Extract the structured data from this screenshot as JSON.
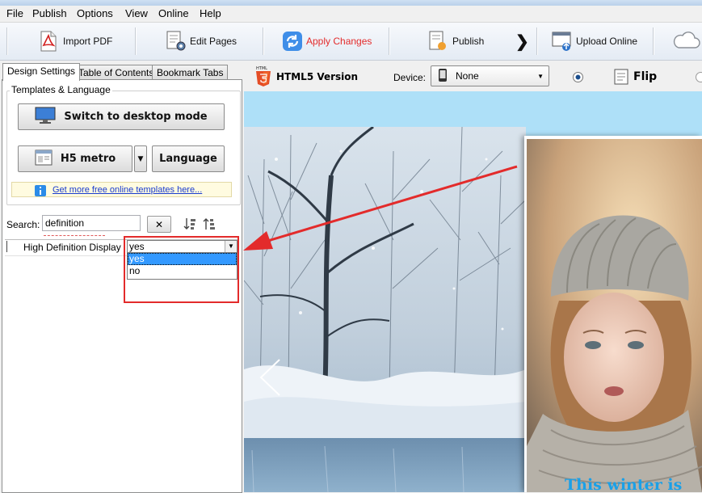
{
  "menu": [
    "File",
    "Publish",
    "Options",
    "View",
    "Online",
    "Help"
  ],
  "toolbar": {
    "import_pdf": "Import PDF",
    "edit_pages": "Edit Pages",
    "apply_changes": "Apply Changes",
    "publish": "Publish",
    "upload_online": "Upload Online"
  },
  "tabs": [
    "Design Settings",
    "Table of Contents",
    "Bookmark Tabs"
  ],
  "templates": {
    "group_label": "Templates & Language",
    "switch_button": "Switch to desktop mode",
    "template_button": "H5 metro",
    "language_button": "Language",
    "more_templates_link": "Get more free online templates here..."
  },
  "search": {
    "label": "Search:",
    "value": "definition"
  },
  "property": {
    "name": "High Definition Display",
    "value": "yes",
    "options": [
      "yes",
      "no"
    ],
    "selected_option": "yes"
  },
  "preview_header": {
    "html5_badge": "HTML",
    "version_label": "HTML5 Version",
    "device_label": "Device:",
    "device_value": "None",
    "flip_label": "Flip"
  },
  "preview": {
    "caption_text": "This winter is"
  },
  "colors": {
    "apply_changes": "#e32b2b",
    "annotation": "#e32b2b",
    "link": "#1a3ccf",
    "preview_bg": "#aee0f8"
  }
}
